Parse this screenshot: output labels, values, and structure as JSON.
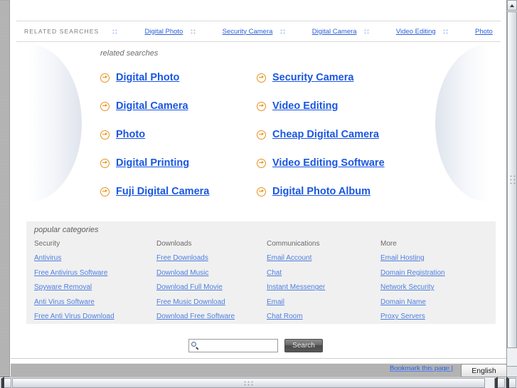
{
  "topbar": {
    "label": "RELATED SEARCHES",
    "links": [
      "Digital Photo",
      "Security Camera",
      "Digital Camera",
      "Video Editing",
      "Photo"
    ]
  },
  "related": {
    "heading": "related searches",
    "links": [
      "Digital Photo",
      "Security Camera",
      "Digital Camera",
      "Video Editing",
      "Photo",
      "Cheap Digital Camera",
      "Digital Printing",
      "Video Editing Software",
      "Fuji Digital Camera",
      "Digital Photo Album"
    ]
  },
  "categories": {
    "heading": "popular categories",
    "columns": [
      {
        "title": "Security",
        "links": [
          "Antivirus",
          "Free Antivirus Software",
          "Spyware Removal",
          "Anti Virus Software",
          "Free Anti Virus Download"
        ]
      },
      {
        "title": "Downloads",
        "links": [
          "Free Downloads",
          "Download Music",
          "Download Full Movie",
          "Free Music Download",
          "Download Free Software"
        ]
      },
      {
        "title": "Communications",
        "links": [
          "Email Account",
          "Chat",
          "Instant Messenger",
          "Email",
          "Chat Room"
        ]
      },
      {
        "title": "More",
        "links": [
          "Email Hosting",
          "Domain Registration",
          "Network Security",
          "Domain Name",
          "Proxy Servers"
        ]
      }
    ]
  },
  "search": {
    "value": "",
    "placeholder": "",
    "button_label": "Search"
  },
  "footer": {
    "bookmark_label": "Bookmark this page |",
    "language": "English"
  },
  "colors": {
    "link_blue": "#1a57e0",
    "topbar_link_blue": "#2b5fd9",
    "category_link_blue": "#4f7fe0",
    "arrow_orange": "#e8911a",
    "panel_gray": "#f0f0f0"
  }
}
